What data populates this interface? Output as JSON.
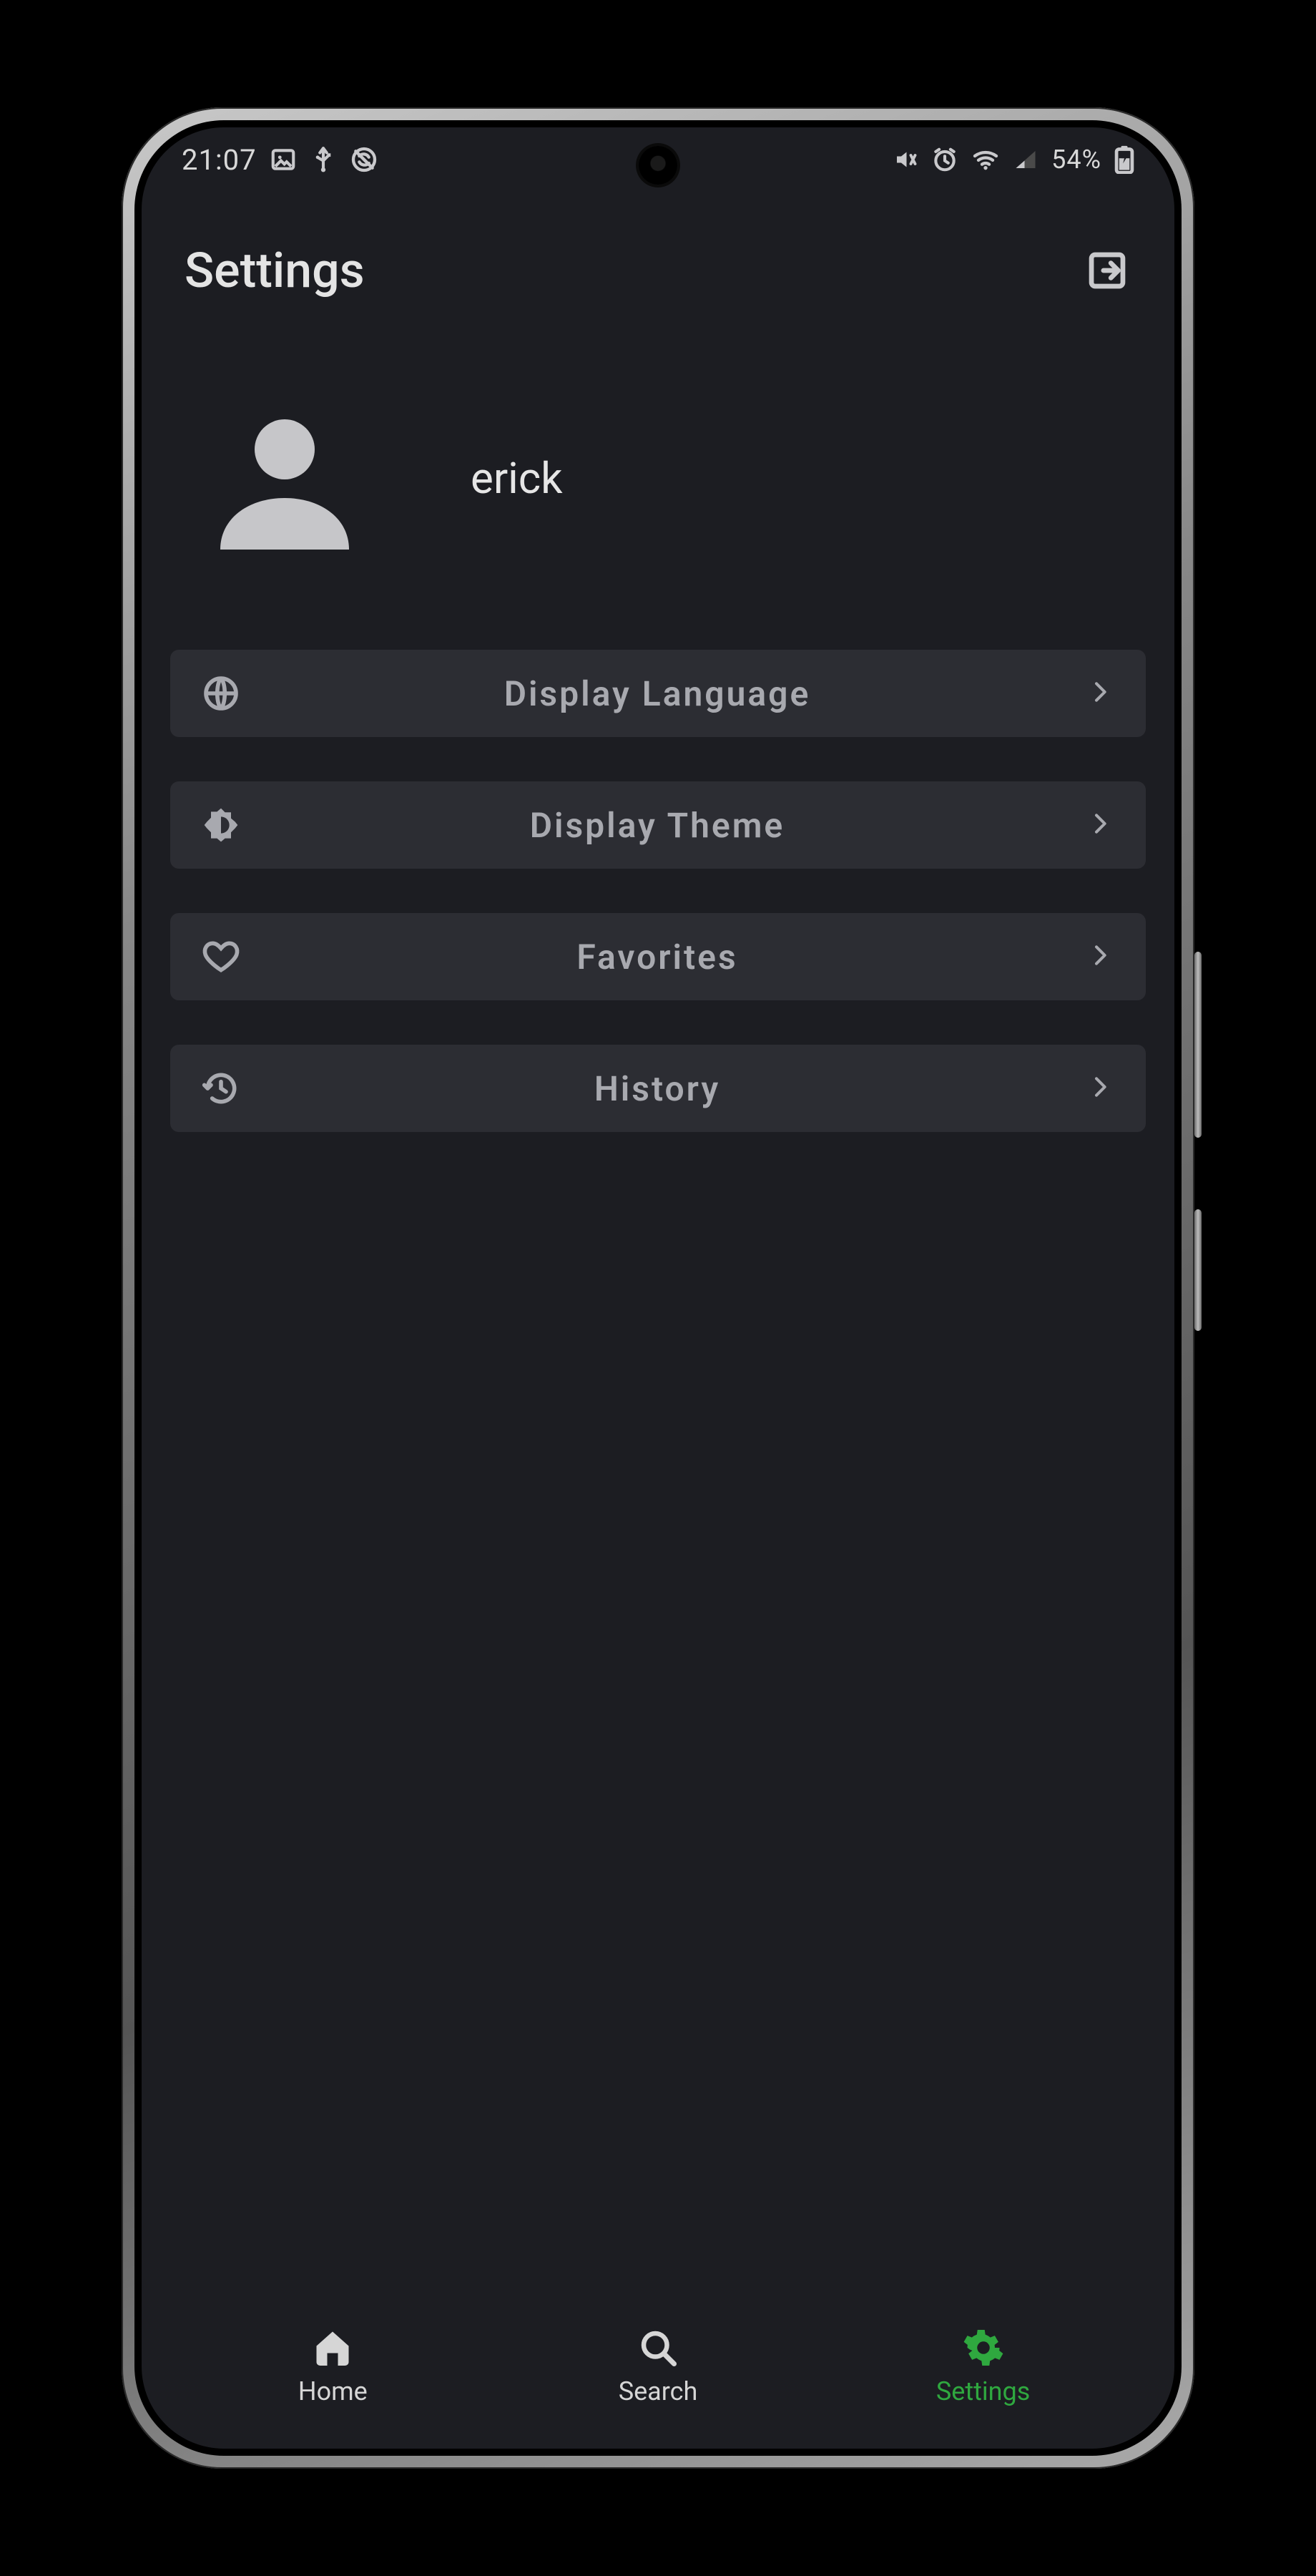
{
  "status": {
    "time": "21:07",
    "battery": "54%"
  },
  "header": {
    "title": "Settings"
  },
  "profile": {
    "username": "erick"
  },
  "items": [
    {
      "label": "Display Language"
    },
    {
      "label": "Display Theme"
    },
    {
      "label": "Favorites"
    },
    {
      "label": "History"
    }
  ],
  "nav": {
    "home": "Home",
    "search": "Search",
    "settings": "Settings"
  }
}
